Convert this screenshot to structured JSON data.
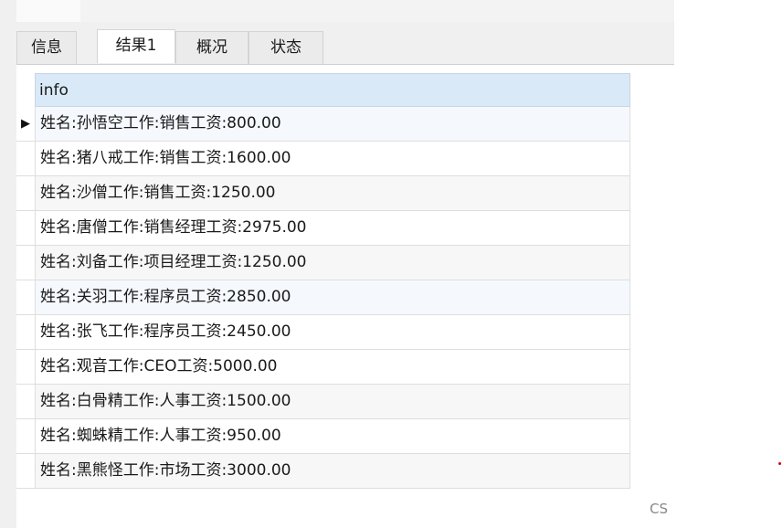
{
  "tabs": [
    {
      "label": "信息",
      "active": false
    },
    {
      "label": "结果1",
      "active": true
    },
    {
      "label": "概况",
      "active": false
    },
    {
      "label": "状态",
      "active": false
    }
  ],
  "grid": {
    "column_header": "info",
    "current_row_marker": "▶",
    "rows": [
      "姓名:孙悟空工作:销售工资:800.00",
      "姓名:猪八戒工作:销售工资:1600.00",
      "姓名:沙僧工作:销售工资:1250.00",
      "姓名:唐僧工作:销售经理工资:2975.00",
      "姓名:刘备工作:项目经理工资:1250.00",
      "姓名:关羽工作:程序员工资:2850.00",
      "姓名:张飞工作:程序员工资:2450.00",
      "姓名:观音工作:CEO工资:5000.00",
      "姓名:白骨精工作:人事工资:1500.00",
      "姓名:蜘蛛精工作:人事工资:950.00",
      "姓名:黑熊怪工作:市场工资:3000.00"
    ]
  },
  "footer": {
    "text": "CS"
  },
  "colors": {
    "header_bg": "#d9e9f7",
    "accent_dot": "#cc0000"
  }
}
